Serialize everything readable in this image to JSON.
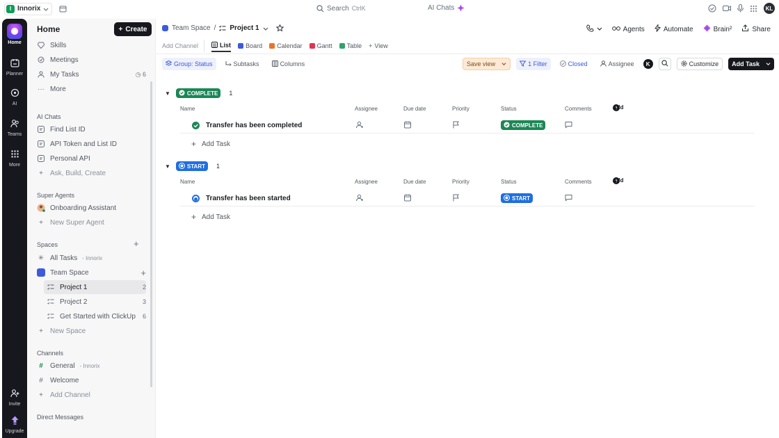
{
  "topbar": {
    "workspace": "Innorix",
    "workspace_initial": "I",
    "search_placeholder": "Search",
    "search_shortcut": "CtrlK",
    "ai_chats": "AI Chats",
    "avatar": "KL"
  },
  "rail": {
    "items": [
      {
        "label": "Home"
      },
      {
        "label": "Planner"
      },
      {
        "label": "AI"
      },
      {
        "label": "Teams"
      },
      {
        "label": "More"
      },
      {
        "label": "Invite"
      },
      {
        "label": "Upgrade"
      }
    ]
  },
  "sidebar": {
    "title": "Home",
    "create": "Create",
    "top_items": [
      {
        "label": "Skills",
        "icon": "diamond-icon"
      },
      {
        "label": "Meetings",
        "icon": "meetings-icon"
      },
      {
        "label": "My Tasks",
        "icon": "user-icon",
        "count": "6"
      },
      {
        "label": "More",
        "icon": "more-icon"
      }
    ],
    "ai_chats_title": "AI Chats",
    "ai_chats": [
      {
        "label": "Find List ID"
      },
      {
        "label": "API Token and List ID"
      },
      {
        "label": "Personal API"
      },
      {
        "label": "Ask, Build, Create"
      }
    ],
    "super_agents_title": "Super Agents",
    "super_agents": [
      {
        "label": "Onboarding Assistant"
      },
      {
        "label": "New Super Agent"
      }
    ],
    "spaces_title": "Spaces",
    "all_tasks": "All Tasks",
    "all_tasks_sub": "- Innorix",
    "team_space": "Team Space",
    "projects": [
      {
        "label": "Project 1",
        "count": "2"
      },
      {
        "label": "Project 2",
        "count": "3"
      },
      {
        "label": "Get Started with ClickUp",
        "count": "6"
      }
    ],
    "new_space": "New Space",
    "channels_title": "Channels",
    "channels": [
      {
        "label": "General",
        "sub": "- Innorix"
      },
      {
        "label": "Welcome"
      },
      {
        "label": "Add Channel"
      }
    ],
    "dm_title": "Direct Messages"
  },
  "header": {
    "breadcrumb_space": "Team Space",
    "breadcrumb_sep": "/",
    "breadcrumb_project": "Project 1",
    "agents": "Agents",
    "automate": "Automate",
    "brain": "Brain²",
    "share": "Share"
  },
  "tabs": [
    {
      "label": "Add Channel"
    },
    {
      "label": "List"
    },
    {
      "label": "Board"
    },
    {
      "label": "Calendar"
    },
    {
      "label": "Gantt"
    },
    {
      "label": "Table"
    },
    {
      "label": "View"
    }
  ],
  "toolbar": {
    "group": "Group: Status",
    "subtasks": "Subtasks",
    "columns": "Columns",
    "save_view": "Save view",
    "filter": "1 Filter",
    "closed": "Closed",
    "assignee": "Assignee",
    "assignee_initial": "K",
    "customize": "Customize",
    "add_task": "Add Task"
  },
  "columns": {
    "name": "Name",
    "assignee": "Assignee",
    "due_date": "Due date",
    "priority": "Priority",
    "status": "Status",
    "comments": "Comments",
    "add": "Add"
  },
  "groups": [
    {
      "status": "COMPLETE",
      "count": "1",
      "color": "#1b8755",
      "task": "Transfer has been completed",
      "add_task": "Add Task"
    },
    {
      "status": "START",
      "count": "1",
      "color": "#1f6fe0",
      "task": "Transfer has been started",
      "add_task": "Add Task"
    }
  ]
}
